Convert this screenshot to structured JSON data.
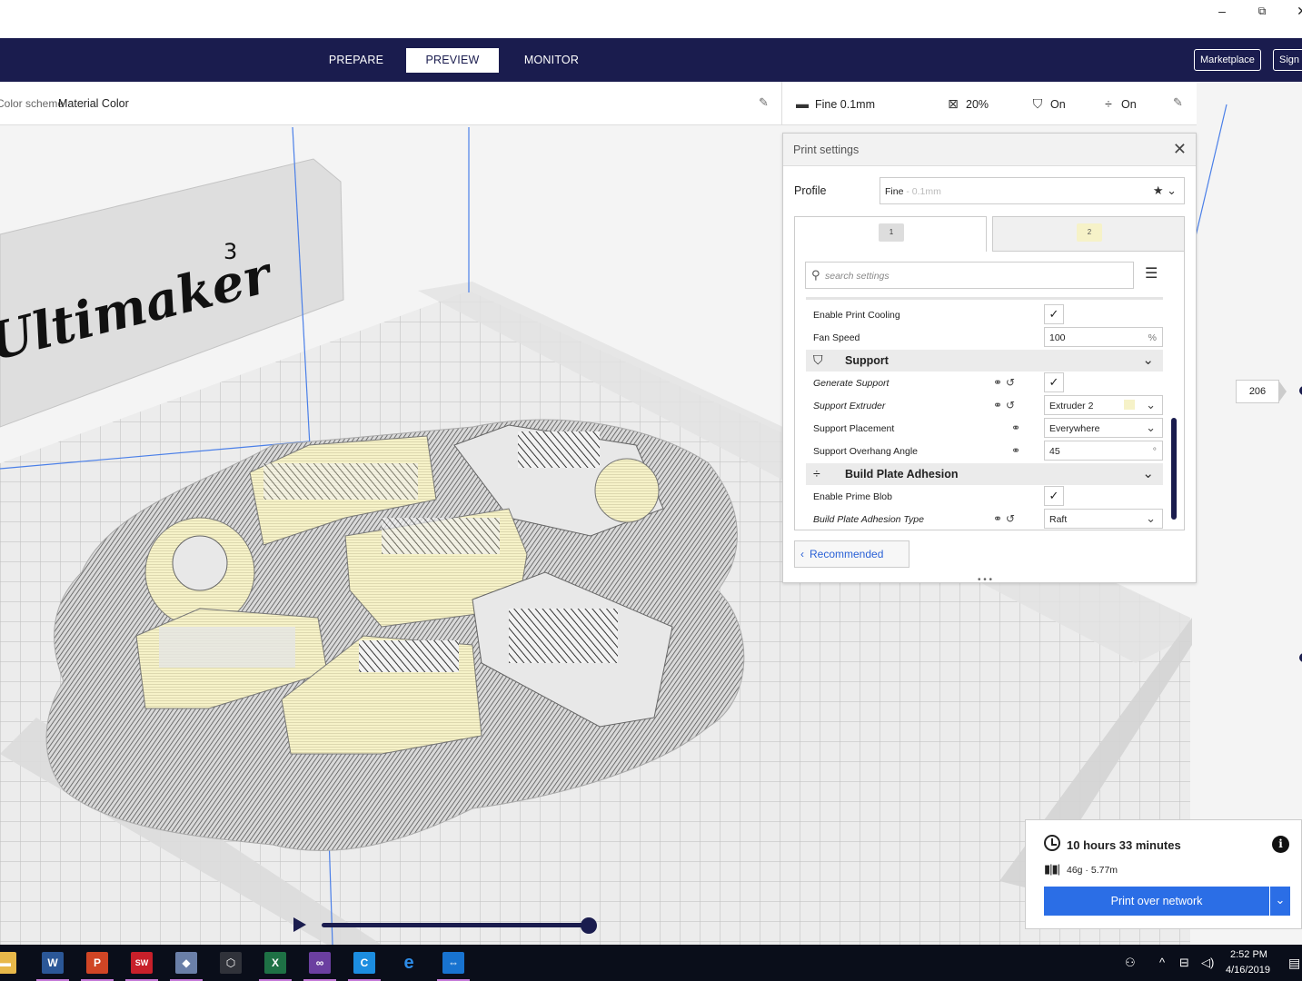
{
  "window": {
    "minimize": "–",
    "restore": "⧉",
    "close": "✕"
  },
  "header": {
    "tabs": [
      {
        "label": "PREPARE",
        "active": false
      },
      {
        "label": "PREVIEW",
        "active": true
      },
      {
        "label": "MONITOR",
        "active": false
      }
    ],
    "marketplace": "Marketplace",
    "sign_in": "Sign in"
  },
  "colors": {
    "brand": "#1a1c4e",
    "accent": "#2b6ee6",
    "material": "#f6f2c8"
  },
  "scheme": {
    "label": "Color scheme",
    "value": "Material Color"
  },
  "summary": {
    "profile": "Fine 0.1mm",
    "infill": "20%",
    "support": "On",
    "adhesion": "On",
    "icons": {
      "profile": "layers-icon",
      "infill": "infill-icon",
      "support": "support-icon",
      "adhesion": "adhesion-icon"
    }
  },
  "print_settings": {
    "title": "Print settings",
    "profile_label": "Profile",
    "profile_name": "Fine",
    "profile_sub": " - 0.1mm",
    "extruder_tabs": [
      "1",
      "2"
    ],
    "search_placeholder": "search settings",
    "rows": [
      {
        "label": "Enable Print Cooling",
        "type": "check",
        "checked": "✓"
      },
      {
        "label": "Fan Speed",
        "type": "input",
        "value": "100",
        "unit": "%"
      }
    ],
    "support_category": "Support",
    "support_rows": [
      {
        "label": "Generate Support",
        "type": "check",
        "checked": "✓"
      },
      {
        "label": "Support Extruder",
        "value": "Extruder 2"
      },
      {
        "label": "Support Placement",
        "value": "Everywhere"
      },
      {
        "label": "Support Overhang Angle",
        "value": "45",
        "unit": "°"
      }
    ],
    "adhesion_category": "Build Plate Adhesion",
    "adhesion_rows": [
      {
        "label": "Enable Prime Blob",
        "type": "check",
        "checked": "✓"
      },
      {
        "label": "Build Plate Adhesion Type",
        "value": "Raft"
      }
    ],
    "recommended": "Recommended"
  },
  "layer_view": {
    "current_layer": "206"
  },
  "scene": {
    "printer_brand_text": "Ultimaker",
    "printer_brand_sup": "3"
  },
  "output": {
    "time": "10 hours 33 minutes",
    "material": "46g · 5.77m",
    "print_button": "Print over network",
    "info": "i"
  },
  "taskbar": {
    "apps": [
      "explorer",
      "word",
      "powerpoint",
      "solidworks",
      "app",
      "app3d",
      "excel",
      "arduino",
      "cura",
      "edge",
      "teamviewer"
    ],
    "time": "2:52 PM",
    "date": "4/16/2019"
  }
}
